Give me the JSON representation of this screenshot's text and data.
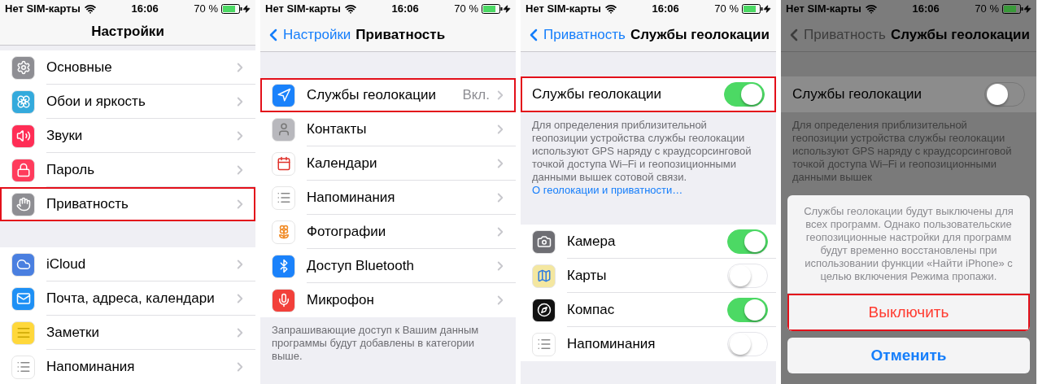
{
  "panels": [
    {
      "kind": "menu",
      "status": {
        "carrier": "Нет SIM-карты",
        "time": "16:06",
        "battery": "70 %"
      },
      "nav": {
        "title": "Настройки"
      },
      "groups": [
        {
          "items": [
            {
              "label": "Основные",
              "color": "#8e8e93",
              "highlighted": false
            },
            {
              "label": "Обои и яркость",
              "color": "#34aadc",
              "highlighted": false
            },
            {
              "label": "Звуки",
              "color": "#ff2d55",
              "highlighted": false
            },
            {
              "label": "Пароль",
              "color": "#ff3b5c",
              "highlighted": false
            },
            {
              "label": "Приватность",
              "color": "#8e8e93",
              "highlighted": true
            }
          ]
        },
        {
          "items": [
            {
              "label": "iCloud",
              "color": "#4a7fe0",
              "highlighted": false
            },
            {
              "label": "Почта, адреса, календари",
              "color": "#1e90f5",
              "highlighted": false
            },
            {
              "label": "Заметки",
              "color": "#ffd83b",
              "highlighted": false
            },
            {
              "label": "Напоминания",
              "color": "#ffffff",
              "highlighted": false
            }
          ]
        }
      ]
    },
    {
      "kind": "menu",
      "status": {
        "carrier": "Нет SIM-карты",
        "time": "16:06",
        "battery": "70 %"
      },
      "nav": {
        "back": "Настройки",
        "title": "Приватность"
      },
      "groups": [
        {
          "items": [
            {
              "label": "Службы геолокации",
              "value": "Вкл.",
              "color": "#1a82fb",
              "highlighted": true
            },
            {
              "label": "Контакты",
              "color": "#b8b8bd",
              "highlighted": false
            },
            {
              "label": "Календари",
              "color": "#ffffff",
              "highlighted": false
            },
            {
              "label": "Напоминания",
              "color": "#ffffff",
              "highlighted": false
            },
            {
              "label": "Фотографии",
              "color": "#ffffff",
              "highlighted": false
            },
            {
              "label": "Доступ Bluetooth",
              "color": "#1a82fb",
              "highlighted": false
            },
            {
              "label": "Микрофон",
              "color": "#f2403a",
              "highlighted": false
            }
          ]
        }
      ],
      "footer": "Запрашивающие доступ к Вашим данным программы будут добавлены в категории выше."
    },
    {
      "kind": "toggles",
      "status": {
        "carrier": "Нет SIM-карты",
        "time": "16:06",
        "battery": "70 %"
      },
      "nav": {
        "back": "Приватность",
        "title": "Службы геолокации"
      },
      "master": {
        "label": "Службы геолокации",
        "on": true,
        "highlighted": true
      },
      "description": "Для определения приблизительной геопозиции устройства службы геолокации используют GPS наряду с краудсорсинговой точкой доступа Wi–Fi и геопозиционными данными вышек сотовой связи.",
      "link": "О геолокации и приватности…",
      "groups": [
        {
          "items": [
            {
              "label": "Камера",
              "color": "#6e6e73",
              "on": true
            },
            {
              "label": "Карты",
              "color": "#f4e7a0",
              "on": false
            },
            {
              "label": "Компас",
              "color": "#111111",
              "on": true
            },
            {
              "label": "Напоминания",
              "color": "#ffffff",
              "on": false
            }
          ]
        }
      ]
    },
    {
      "kind": "alert",
      "status": {
        "carrier": "Нет SIM-карты",
        "time": "16:06",
        "battery": "70 %"
      },
      "nav": {
        "back": "Приватность",
        "title": "Службы геолокации"
      },
      "master": {
        "label": "Службы геолокации",
        "on": false,
        "highlighted": false
      },
      "description": "Для определения приблизительной геопозиции устройства службы геолокации используют GPS наряду с краудсорсинговой точкой доступа Wi–Fi и геопозиционными данными вышек",
      "alert": {
        "message": "Службы геолокации будут выключены для всех программ. Однако пользовательские геопозиционные настройки для программ будут временно восстановлены при использовании функции «Найти iPhone» с целью включения Режима пропажи.",
        "actions": [
          {
            "label": "Выключить",
            "kind": "destructive",
            "highlighted": true
          },
          {
            "label": "Отменить",
            "kind": "cancel",
            "highlighted": false
          }
        ]
      }
    }
  ]
}
